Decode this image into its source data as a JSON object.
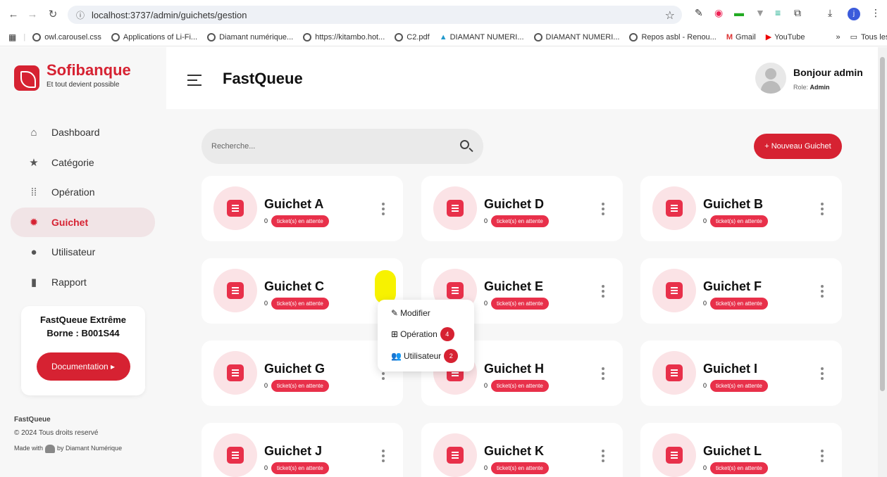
{
  "browser": {
    "url": "localhost:3737/admin/guichets/gestion",
    "bookmarks": [
      "owl.carousel.css",
      "Applications of Li-Fi...",
      "Diamant numérique...",
      "https://kitambo.hot...",
      "C2.pdf",
      "DIAMANT NUMERI...",
      "DIAMANT NUMERI...",
      "Repos asbl - Renou...",
      "Gmail",
      "YouTube"
    ],
    "more": "»",
    "favorites": "Tous les favoris",
    "profile_initial": "j"
  },
  "sidebar": {
    "brand": "Sofibanque",
    "tagline": "Et tout devient possible",
    "items": [
      {
        "label": "Dashboard",
        "icon": "home-icon"
      },
      {
        "label": "Catégorie",
        "icon": "star-icon"
      },
      {
        "label": "Opération",
        "icon": "grid-icon"
      },
      {
        "label": "Guichet",
        "icon": "gear-icon"
      },
      {
        "label": "Utilisateur",
        "icon": "user-icon"
      },
      {
        "label": "Rapport",
        "icon": "file-icon"
      }
    ],
    "promo_title": "FastQueue Extrême",
    "promo_sub": "Borne : B001S44",
    "doc_button": "Documentation ▸",
    "footer_app": "FastQueue",
    "footer_copy": "© 2024 Tous droits reservé",
    "footer_made_with": "Made with",
    "footer_by": "by Diamant Numérique"
  },
  "header": {
    "title": "FastQueue",
    "greeting": "Bonjour admin",
    "role_label": "Role:",
    "role": "Admin"
  },
  "main": {
    "search_placeholder": "Recherche...",
    "new_button": "+ Nouveau Guichet",
    "badge_text": "ticket(s) en attente",
    "cards": [
      {
        "name": "Guichet A",
        "count": "0"
      },
      {
        "name": "Guichet D",
        "count": "0"
      },
      {
        "name": "Guichet B",
        "count": "0"
      },
      {
        "name": "Guichet C",
        "count": "0"
      },
      {
        "name": "Guichet E",
        "count": "0"
      },
      {
        "name": "Guichet F",
        "count": "0"
      },
      {
        "name": "Guichet G",
        "count": "0"
      },
      {
        "name": "Guichet H",
        "count": "0"
      },
      {
        "name": "Guichet I",
        "count": "0"
      },
      {
        "name": "Guichet J",
        "count": "0"
      },
      {
        "name": "Guichet K",
        "count": "0"
      },
      {
        "name": "Guichet L",
        "count": "0"
      }
    ]
  },
  "menu_popup": {
    "items": [
      {
        "label": "Modifier",
        "icon": "edit-icon"
      },
      {
        "label": "Opération",
        "icon": "table-icon",
        "count": "4"
      },
      {
        "label": "Utilisateur",
        "icon": "users-icon",
        "count": "2"
      }
    ]
  },
  "colors": {
    "primary": "#d62232",
    "badge": "#e8304a",
    "highlight": "#f7f200"
  }
}
